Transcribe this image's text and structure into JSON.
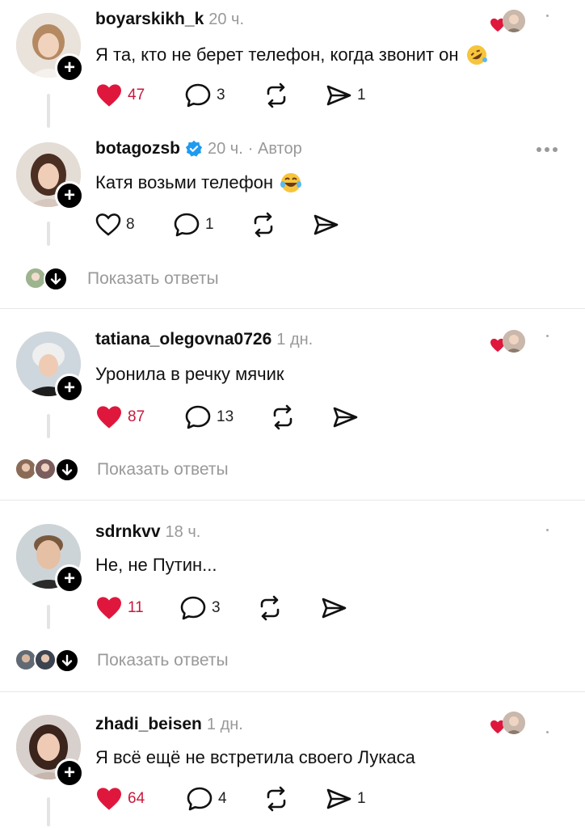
{
  "colors": {
    "like_red": "#e0173d",
    "count_red": "#c8193c",
    "muted": "#999999",
    "verified_blue": "#1d9bf0"
  },
  "posts": [
    {
      "username": "boyarskikh_k",
      "time": "20 ч.",
      "author_badge": "",
      "text": "Я та, кто не берет телефон, когда звонит он",
      "emoji": "rolling-on-floor-laughing-emoji",
      "likes": "47",
      "liked": true,
      "replies": "3",
      "reposts": "",
      "shares": "1",
      "author_liked": true,
      "show_replies": ""
    },
    {
      "username": "botagozsb",
      "verified": true,
      "time": "20 ч.",
      "author_badge": "· Автор",
      "text": "Катя возьми телефон",
      "emoji": "tears-of-joy-emoji",
      "likes": "8",
      "liked": false,
      "replies": "1",
      "reposts": "",
      "shares": "",
      "author_liked": false,
      "show_replies": "Показать ответы"
    },
    {
      "username": "tatiana_olegovna0726",
      "time": "1 дн.",
      "author_badge": "",
      "text": "Уронила в речку мячик",
      "likes": "87",
      "liked": true,
      "replies": "13",
      "reposts": "",
      "shares": "",
      "author_liked": true,
      "show_replies": "Показать ответы"
    },
    {
      "username": "sdrnkvv",
      "time": "18 ч.",
      "author_badge": "",
      "text": "Не, не Путин...",
      "likes": "11",
      "liked": true,
      "replies": "3",
      "reposts": "",
      "shares": "",
      "author_liked": false,
      "show_replies": "Показать ответы"
    },
    {
      "username": "zhadi_beisen",
      "time": "1 дн.",
      "author_badge": "",
      "text": "Я всё ещё не встретила своего Лукаса",
      "likes": "64",
      "liked": true,
      "replies": "4",
      "reposts": "",
      "shares": "1",
      "author_liked": true,
      "show_replies": ""
    }
  ]
}
